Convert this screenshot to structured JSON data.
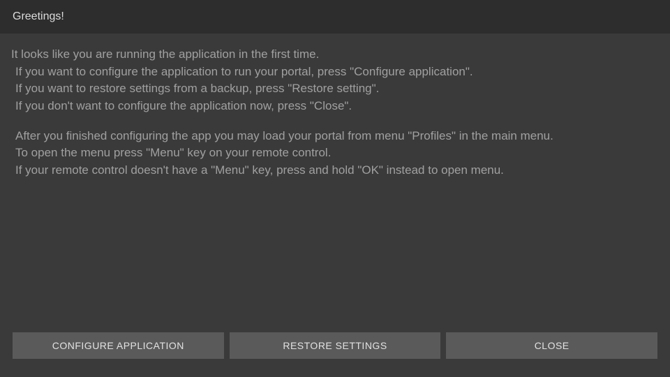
{
  "titlebar": {
    "title": "Greetings!"
  },
  "content": {
    "line1": "It looks like you are running the application in the first time.",
    "line2": "If you want to configure the application to run your portal, press \"Configure application\".",
    "line3": "If you want to restore settings from a backup, press \"Restore setting\".",
    "line4": "If you don't want to configure the application now, press \"Close\".",
    "line5": "After you finished configuring the app you may load your portal from menu \"Profiles\" in the main menu.",
    "line6": "To open the menu press \"Menu\" key on your remote control.",
    "line7": "If your remote control doesn't have a \"Menu\" key, press and hold \"OK\" instead to open menu."
  },
  "buttons": {
    "configure": "CONFIGURE APPLICATION",
    "restore": "RESTORE SETTINGS",
    "close": "CLOSE"
  }
}
